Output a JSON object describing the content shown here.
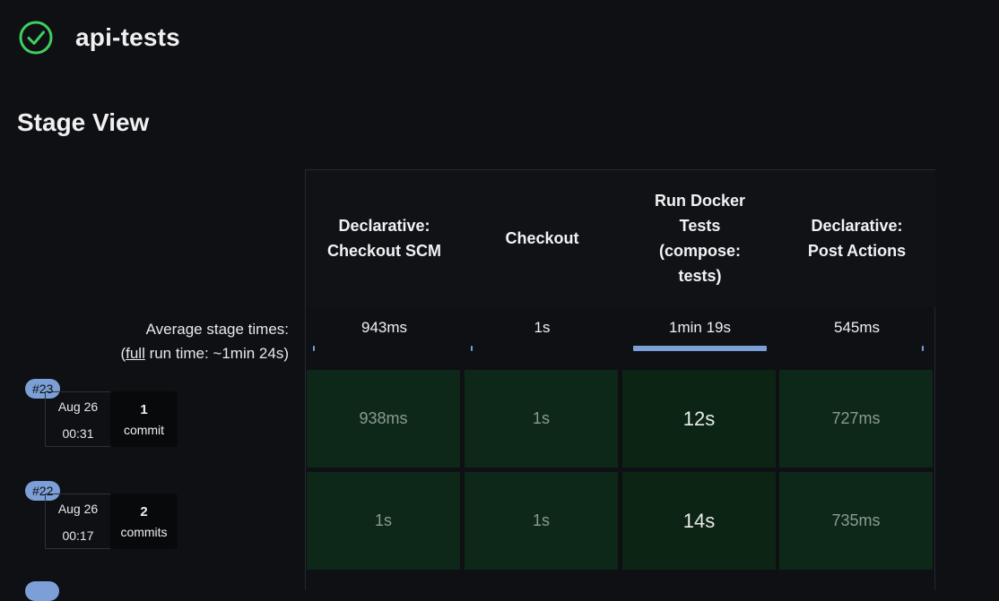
{
  "header": {
    "job_name": "api-tests",
    "status_icon": "success-check-icon",
    "status_color": "#3fcf5e"
  },
  "section_title": "Stage View",
  "stages": [
    {
      "name": "Declarative:\nCheckout SCM",
      "avg": "943ms",
      "avg_fraction": 0.012
    },
    {
      "name": "Checkout",
      "avg": "1s",
      "avg_fraction": 0.013
    },
    {
      "name": "Run Docker\nTests\n(compose:\ntests)",
      "avg": "1min 19s",
      "avg_fraction": 1.0
    },
    {
      "name": "Declarative:\nPost Actions",
      "avg": "545ms",
      "avg_fraction": 0.007
    }
  ],
  "avg_label": {
    "line1": "Average stage times:",
    "full": "full",
    "line2_rest": " run time: ~1min 24s)",
    "open_paren": "("
  },
  "runs": [
    {
      "build": "#23",
      "date": "Aug 26",
      "time": "00:31",
      "commit_count": "1",
      "commit_label": "commit",
      "cells": [
        "938ms",
        "1s",
        "12s",
        "727ms"
      ]
    },
    {
      "build": "#22",
      "date": "Aug 26",
      "time": "00:17",
      "commit_count": "2",
      "commit_label": "commits",
      "cells": [
        "1s",
        "1s",
        "14s",
        "735ms"
      ]
    }
  ],
  "colors": {
    "accent": "#7b9fd6",
    "success_cell": "#0d2818",
    "background": "#0f1014"
  }
}
